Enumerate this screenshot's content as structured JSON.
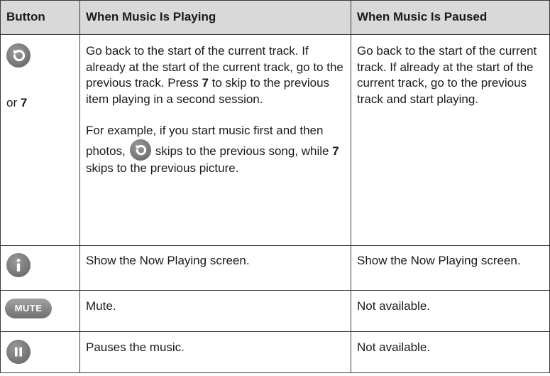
{
  "headers": {
    "button": "Button",
    "playing": "When Music Is Playing",
    "paused": "When Music Is Paused"
  },
  "rows": [
    {
      "icon": "replay-icon",
      "or_prefix": "or ",
      "or_key": "7",
      "playing_p1": "Go back to the start of the current track. If already at the start of the current track, go to the previous track.",
      "playing_p1_press": "Press ",
      "playing_p1_key": "7",
      "playing_p1_tail": " to skip to the previous item playing in a second session.",
      "playing_p2_a": "For example, if you start music first and then photos,",
      "playing_p2_b": "skips to the previous song, while ",
      "playing_p2_key": "7",
      "playing_p2_c": " skips to the previous picture.",
      "paused": "Go back to the start of the current track. If already at the start of the current track, go to the previous track and start playing."
    },
    {
      "icon": "info-icon",
      "playing": "Show the Now Playing screen.",
      "paused": "Show the Now Playing screen."
    },
    {
      "icon": "mute-icon",
      "icon_label": "MUTE",
      "playing": "Mute.",
      "paused": "Not available."
    },
    {
      "icon": "pause-icon",
      "playing": "Pauses the music.",
      "paused": "Not available."
    }
  ],
  "colors": {
    "header_bg": "#d9d9d9",
    "border": "#3a3a3a",
    "icon_gray": "#7a7a7a"
  }
}
